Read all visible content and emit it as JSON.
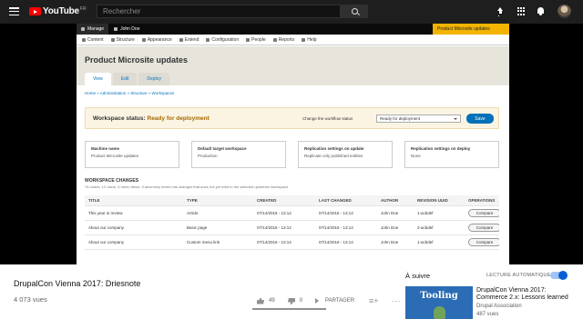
{
  "youtube": {
    "logo_text": "YouTube",
    "region": "FR",
    "search_placeholder": "Rechercher",
    "colors": {
      "brand_red": "#ff0000",
      "toggle_blue": "#065fd4"
    }
  },
  "drupal": {
    "admin_bar": {
      "manage": "Manage",
      "user": "John Doe",
      "workspace": "Product Microsite updates"
    },
    "toolbar": [
      "Content",
      "Structure",
      "Appearance",
      "Extend",
      "Configuration",
      "People",
      "Reports",
      "Help"
    ],
    "page_title": "Product Microsite updates",
    "tabs": [
      "View",
      "Edit",
      "Deploy"
    ],
    "breadcrumb": "Home » Administration » Structure » Workspaces",
    "status": {
      "label": "Workspace status:",
      "value": "Ready for deployment",
      "change_label": "Change the workflow status",
      "select_value": "Ready for deployment",
      "save": "Save"
    },
    "cards": [
      {
        "heading": "Machine name",
        "value": "Product Microsite updates"
      },
      {
        "heading": "Default target workspace",
        "value": "Production"
      },
      {
        "heading": "Replication settings on update",
        "value": "Replicate only published entities"
      },
      {
        "heading": "Replication settings on deploy",
        "value": "None"
      }
    ],
    "changes": {
      "heading": "WORKSPACE CHANGES",
      "summary": "76 nodes, 12 users, 5 menu items, 9 taxonomy terms has changed that does not yet exist in the selected upstream workspace",
      "headers": [
        "TITLE",
        "TYPE",
        "CREATED",
        "LAST CHANGED",
        "AUTHOR",
        "REVISION UUID",
        "OPERATIONS"
      ],
      "rows": [
        [
          "This year in review",
          "Article",
          "07/14/2016 - 13:14",
          "07/14/2016 - 13:14",
          "John Doe",
          "1-acbdef",
          "Compare"
        ],
        [
          "About our company",
          "Basic page",
          "07/14/2016 - 13:14",
          "07/14/2016 - 13:14",
          "John Doe",
          "2-acbdef",
          "Compare"
        ],
        [
          "About our company",
          "Custom menu link",
          "07/14/2016 - 13:14",
          "07/14/2016 - 13:14",
          "John Doe",
          "1-acbdef",
          "Compare"
        ]
      ]
    }
  },
  "video": {
    "title": "DrupalCon Vienna 2017: Driesnote",
    "views": "4 073 vues",
    "likes": "49",
    "dislikes": "0",
    "share": "PARTAGER",
    "like_ratio": 1.0
  },
  "up_next": {
    "label": "À suivre",
    "autoplay_label": "LECTURE AUTOMATIQUE",
    "autoplay_on": true,
    "thumb_text": "Tooling",
    "title": "DrupalCon Vienna 2017: Commerce 2.x: Lessons learned",
    "channel": "Drupal Association",
    "views": "487 vues"
  }
}
